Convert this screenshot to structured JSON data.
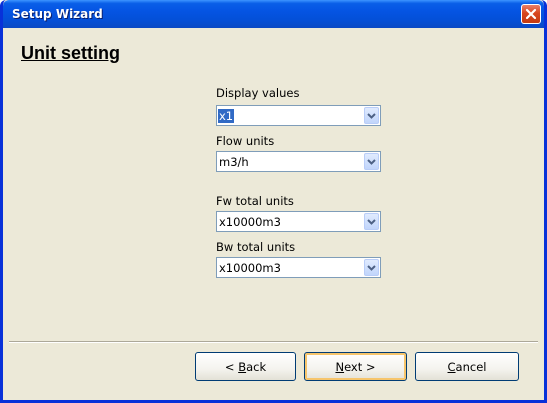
{
  "window": {
    "title": "Setup Wizard"
  },
  "page": {
    "heading": "Unit setting"
  },
  "fields": [
    {
      "label": "Display values",
      "value": "x1",
      "selected": true
    },
    {
      "label": "Flow units",
      "value": "m3/h",
      "selected": false
    },
    {
      "label": "Fw total units",
      "value": "x10000m3",
      "selected": false
    },
    {
      "label": "Bw total units",
      "value": "x10000m3",
      "selected": false
    }
  ],
  "buttons": {
    "back": {
      "prefix": "< ",
      "mnemonic": "B",
      "rest": "ack"
    },
    "next": {
      "prefix": "",
      "mnemonic": "N",
      "rest": "ext >"
    },
    "cancel": {
      "prefix": "",
      "mnemonic": "C",
      "rest": "ancel"
    }
  },
  "icons": {
    "close": "close-icon",
    "dropdown": "chevron-down-icon"
  },
  "colors": {
    "titlebar": "#0554e3",
    "close": "#d8461f",
    "selection": "#316ac5",
    "background": "#ece9d8"
  }
}
